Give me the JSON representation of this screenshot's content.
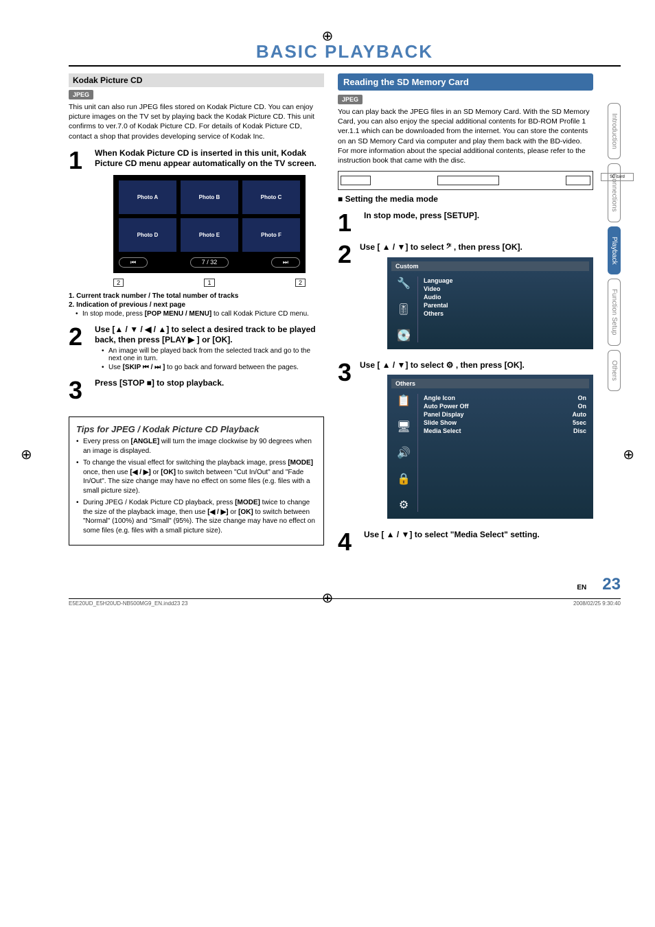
{
  "title": "BASIC PLAYBACK",
  "left": {
    "kodak_header": "Kodak Picture CD",
    "badge": "JPEG",
    "intro": "This unit can also run JPEG files stored on Kodak Picture CD. You can enjoy picture images on the TV set by playing back the Kodak Picture CD. This unit confirms to ver.7.0 of Kodak Picture CD. For details of Kodak Picture CD, contact a shop that provides developing service of Kodak Inc.",
    "step1": {
      "num": "1",
      "title": "When Kodak Picture CD is inserted in this unit, Kodak Picture CD menu appear automatically on the TV screen."
    },
    "photos": [
      "Photo A",
      "Photo B",
      "Photo C",
      "Photo D",
      "Photo E",
      "Photo F"
    ],
    "nav_prev": "⏮",
    "nav_count": "7 /   32",
    "nav_next": "⏭",
    "leaders": {
      "left": "2",
      "mid": "1",
      "right": "2"
    },
    "note1": "1.  Current track number / The total number of tracks",
    "note2": "2.  Indication of previous / next page",
    "note2_sub_a": "In stop mode, press ",
    "note2_sub_b": "[POP MENU / MENU]",
    "note2_sub_c": " to call Kodak Picture CD menu.",
    "step2": {
      "num": "2",
      "title": "Use [▲ / ▼ / ◀ / ▲] to select a desired track to be played back, then press [PLAY ▶ ] or [OK].",
      "b1": "An image will be played back from the selected track and go to the next one in turn.",
      "b2_a": "Use ",
      "b2_b": "[SKIP ⏮ / ⏭ ]",
      "b2_c": " to go back and forward between the pages."
    },
    "step3": {
      "num": "3",
      "title": "Press [STOP ■] to stop playback."
    },
    "tips": {
      "title": "Tips for JPEG / Kodak Picture CD Playback",
      "t1_a": "Every press on ",
      "t1_b": "[ANGLE]",
      "t1_c": " will turn the image clockwise by 90 degrees when an image is displayed.",
      "t2_a": "To change the visual effect for switching the playback image, press ",
      "t2_b": "[MODE]",
      "t2_c": " once, then use ",
      "t2_d": "[◀ / ▶]",
      "t2_e": " or ",
      "t2_f": "[OK]",
      "t2_g": " to switch between \"Cut In/Out\" and \"Fade In/Out\". The size change may have no effect on some files (e.g. files with a small picture size).",
      "t3_a": "During JPEG / Kodak Picture CD playback, press ",
      "t3_b": "[MODE]",
      "t3_c": " twice to change the size of the playback image, then use ",
      "t3_d": "[◀ / ▶]",
      "t3_e": " or ",
      "t3_f": "[OK]",
      "t3_g": " to switch between \"Normal\" (100%) and \"Small\" (95%). The size change may have no effect on some files (e.g. files with a small picture size)."
    }
  },
  "right": {
    "reading_header": "Reading the SD Memory Card",
    "badge": "JPEG",
    "intro": "You can play back the JPEG files in an SD Memory Card. With the SD Memory Card, you can also enjoy the special additional contents for BD-ROM Profile 1 ver.1.1 which can be downloaded from the internet. You can store the contents on an SD Memory Card via computer and play them back with the BD-video. For more information about the special additional contents, please refer to the instruction book that came with the disc.",
    "device_sd": "SD card",
    "sub_heading": "Setting the media mode",
    "step1": {
      "num": "1",
      "title": "In stop mode, press [SETUP]."
    },
    "step2": {
      "num": "2",
      "title": "Use [ ▲ / ▼] to select 𝄢 , then press [OK]."
    },
    "menu1": {
      "header": "Custom",
      "items": [
        "Language",
        "Video",
        "Audio",
        "Parental",
        "Others"
      ]
    },
    "step3": {
      "num": "3",
      "title": "Use [ ▲ / ▼] to select ⚙ , then press [OK]."
    },
    "menu2": {
      "header": "Others",
      "rows": [
        {
          "k": "Angle Icon",
          "v": "On"
        },
        {
          "k": "Auto Power Off",
          "v": "On"
        },
        {
          "k": "Panel Display",
          "v": "Auto"
        },
        {
          "k": "Slide Show",
          "v": "5sec"
        },
        {
          "k": "Media Select",
          "v": "Disc"
        }
      ]
    },
    "step4": {
      "num": "4",
      "title": "Use [ ▲ / ▼] to select \"Media Select\" setting."
    }
  },
  "tabs": [
    "Introduction",
    "Connections",
    "Playback",
    "Function Setup",
    "Others"
  ],
  "footer": {
    "en": "EN",
    "page": "23",
    "file": "E5E20UD_E5H20UD-NB500MG9_EN.indd23   23",
    "date": "2008/02/25   9:30:40"
  }
}
